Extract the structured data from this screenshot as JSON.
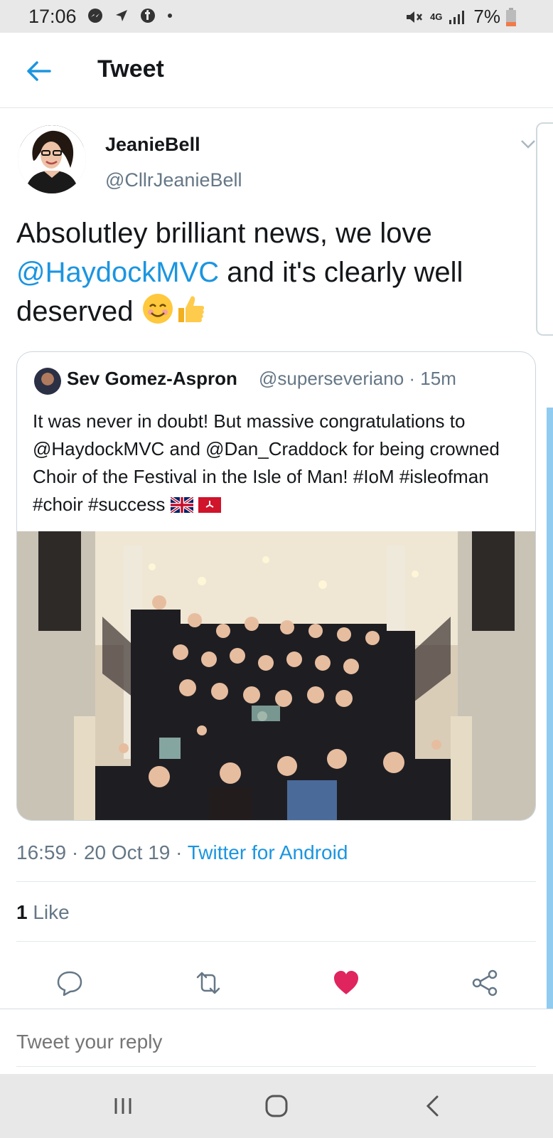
{
  "status_bar": {
    "time": "17:06",
    "battery": "7%",
    "network": "4G",
    "left_icons": [
      "messenger-icon",
      "navigation-icon",
      "facebook-icon",
      "dot-icon"
    ],
    "right_icons": [
      "mute-icon",
      "network-4g-icon",
      "signal-icon",
      "battery-icon"
    ]
  },
  "header": {
    "title": "Tweet",
    "back_icon": "back-arrow-icon"
  },
  "tweet": {
    "display_name": "JeanieBell",
    "handle": "@CllrJeanieBell",
    "text_part1": "Absolutley brilliant news, we love ",
    "mention": "@HaydockMVC",
    "text_part2": " and it's clearly well deserved ",
    "emojis": [
      "smiling-face-icon",
      "thumbs-up-icon"
    ],
    "timestamp": "16:59 · 20 Oct 19 · ",
    "source": "Twitter for Android",
    "like_count": "1",
    "like_label": " Like"
  },
  "quoted_tweet": {
    "display_name": "Sev Gomez-Aspron",
    "handle": "@superseveriano",
    "time_ago": "· 15m",
    "text": "It was never in doubt! But massive congratulations to @HaydockMVC and @Dan_Craddock for being crowned Choir of the Festival in the Isle of Man! #IoM #isleofman #choir #success",
    "flags": [
      "uk-flag-icon",
      "isle-of-man-flag-icon"
    ]
  },
  "actions": [
    "reply-icon",
    "retweet-icon",
    "like-icon",
    "share-icon"
  ],
  "reply": {
    "placeholder": "Tweet your reply"
  },
  "colors": {
    "accent": "#1b95e0",
    "like": "#e0245e",
    "secondary_text": "#657786"
  }
}
